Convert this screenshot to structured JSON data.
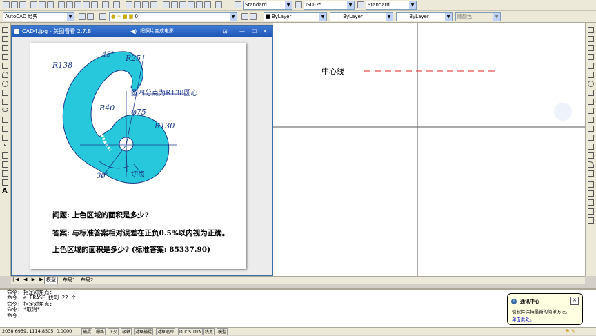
{
  "toolbar": {
    "workspace": "AutoCAD 经典",
    "layer": "0",
    "text_style": "Standard",
    "dim_style": "ISO-25",
    "table_style": "Standard",
    "color": "ByLayer",
    "linetype": "ByLayer",
    "lineweight": "ByLayer",
    "plot_style": "随颜色"
  },
  "viewer": {
    "title": "CAD4.jpg - 美图看看 2.7.8",
    "notice": "把照片变成电影!",
    "drawing": {
      "r138": "R138",
      "r25": "R25",
      "angle45": "45°",
      "note": "圆四分点为R138圆心",
      "r40": "R40",
      "phi75": "φ75",
      "r130": "R130",
      "angle30": "30°",
      "tangent": "切点"
    },
    "question": "问题: 上色区域的面积是多少?",
    "answer": "答案: 与标准答案相对误差在正负0.5%以内视为正确。",
    "ask": "上色区域的面积是多少? (标准答案: 85337.90)"
  },
  "canvas": {
    "centerline_label": "中心线"
  },
  "tabs": {
    "model": "模型",
    "layout1": "布局1",
    "layout2": "布局2"
  },
  "command_lines": [
    "命令: 指定对角点:",
    "命令: e ERASE 找到 22 个",
    "命令: 指定对角点:",
    "命令: *取消*",
    "命令:"
  ],
  "status": {
    "coords": "2038.6959, 1114.8505, 0.0000",
    "buttons": [
      "捕捉",
      "栅格",
      "正交",
      "极轴",
      "对象捕捉",
      "对象追踪",
      "DUCS",
      "DYN",
      "线宽",
      "模型"
    ]
  },
  "balloon": {
    "title": "通讯中心",
    "text": "使软件保持最新的简单方法。",
    "link": "单击此处。"
  },
  "colors": {
    "fill": "#27c8db",
    "ink": "#1e3a8a",
    "centerline": "#e02020",
    "titlebar": "#2a63c4"
  }
}
